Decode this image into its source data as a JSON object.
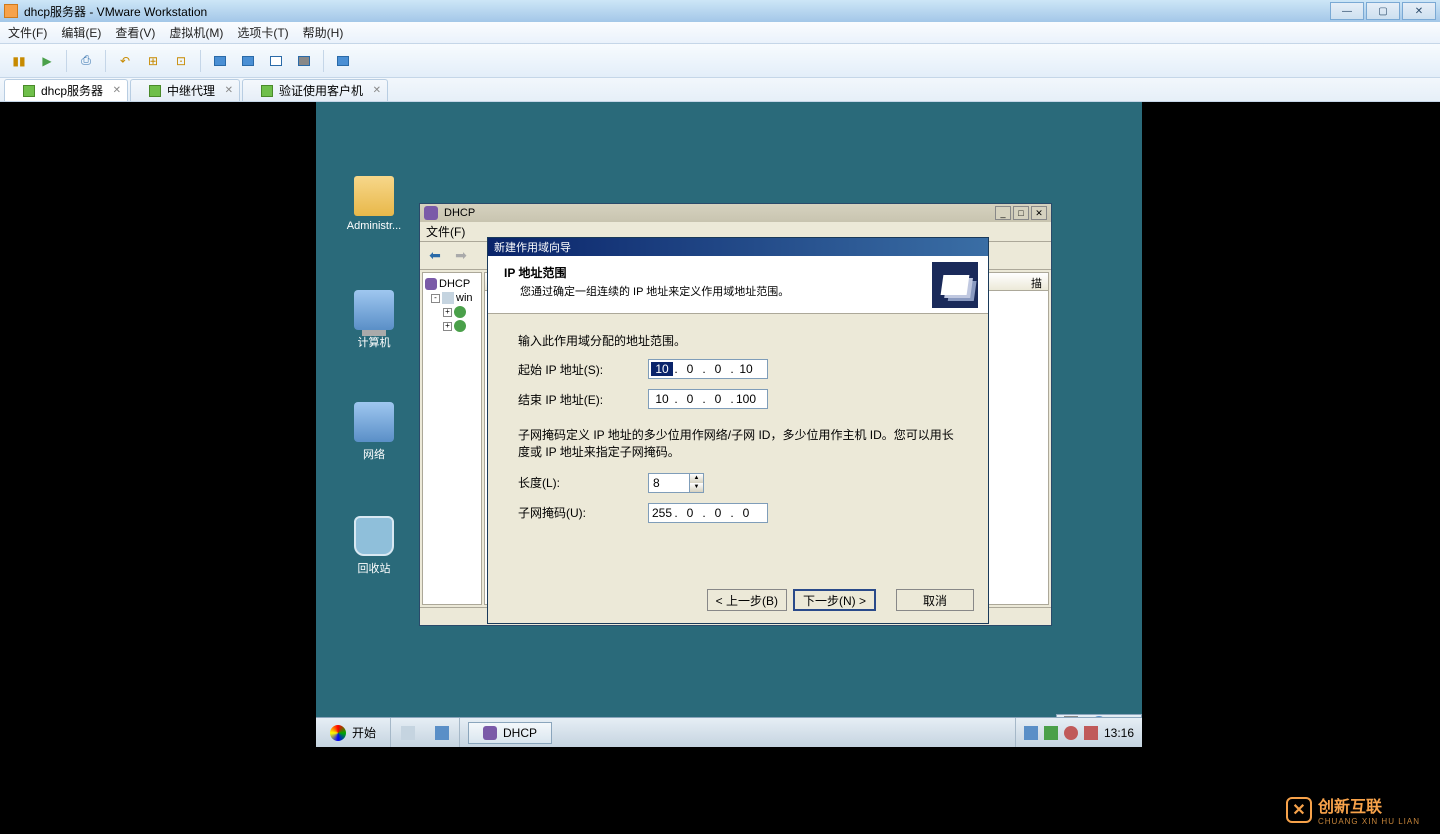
{
  "vmware": {
    "title": "dhcp服务器 - VMware Workstation",
    "menu": [
      "文件(F)",
      "编辑(E)",
      "查看(V)",
      "虚拟机(M)",
      "选项卡(T)",
      "帮助(H)"
    ],
    "tabs": [
      {
        "label": "dhcp服务器"
      },
      {
        "label": "中继代理"
      },
      {
        "label": "验证使用客户机"
      }
    ],
    "win_btns": {
      "min": "—",
      "max": "▢",
      "close": "✕"
    }
  },
  "desktop": {
    "icons": [
      {
        "label": "Administr..."
      },
      {
        "label": "计算机"
      },
      {
        "label": "网络"
      },
      {
        "label": "回收站"
      }
    ]
  },
  "taskbar": {
    "start": "开始",
    "task": "DHCP",
    "time": "13:16"
  },
  "mmc": {
    "title": "DHCP",
    "menu_file": "文件(F)",
    "tree_root": "DHCP",
    "tree_server": "win",
    "right_header": "描"
  },
  "wizard": {
    "title": "新建作用域向导",
    "head1": "IP 地址范围",
    "head2": "您通过确定一组连续的 IP 地址来定义作用域地址范围。",
    "body_lbl": "输入此作用域分配的地址范围。",
    "start_lbl": "起始 IP 地址(S):",
    "end_lbl": "结束 IP 地址(E):",
    "start_ip": [
      "10",
      "0",
      "0",
      "10"
    ],
    "end_ip": [
      "10",
      "0",
      "0",
      "100"
    ],
    "para": "子网掩码定义 IP 地址的多少位用作网络/子网 ID，多少位用作主机 ID。您可以用长度或 IP 地址来指定子网掩码。",
    "len_lbl": "长度(L):",
    "len_val": "8",
    "mask_lbl": "子网掩码(U):",
    "mask_ip": [
      "255",
      "0",
      "0",
      "0"
    ],
    "btn_back": "< 上一步(B)",
    "btn_next": "下一步(N) >",
    "btn_cancel": "取消"
  },
  "watermark": {
    "main": "创新互联",
    "sub": "CHUANG XIN HU LIAN"
  }
}
